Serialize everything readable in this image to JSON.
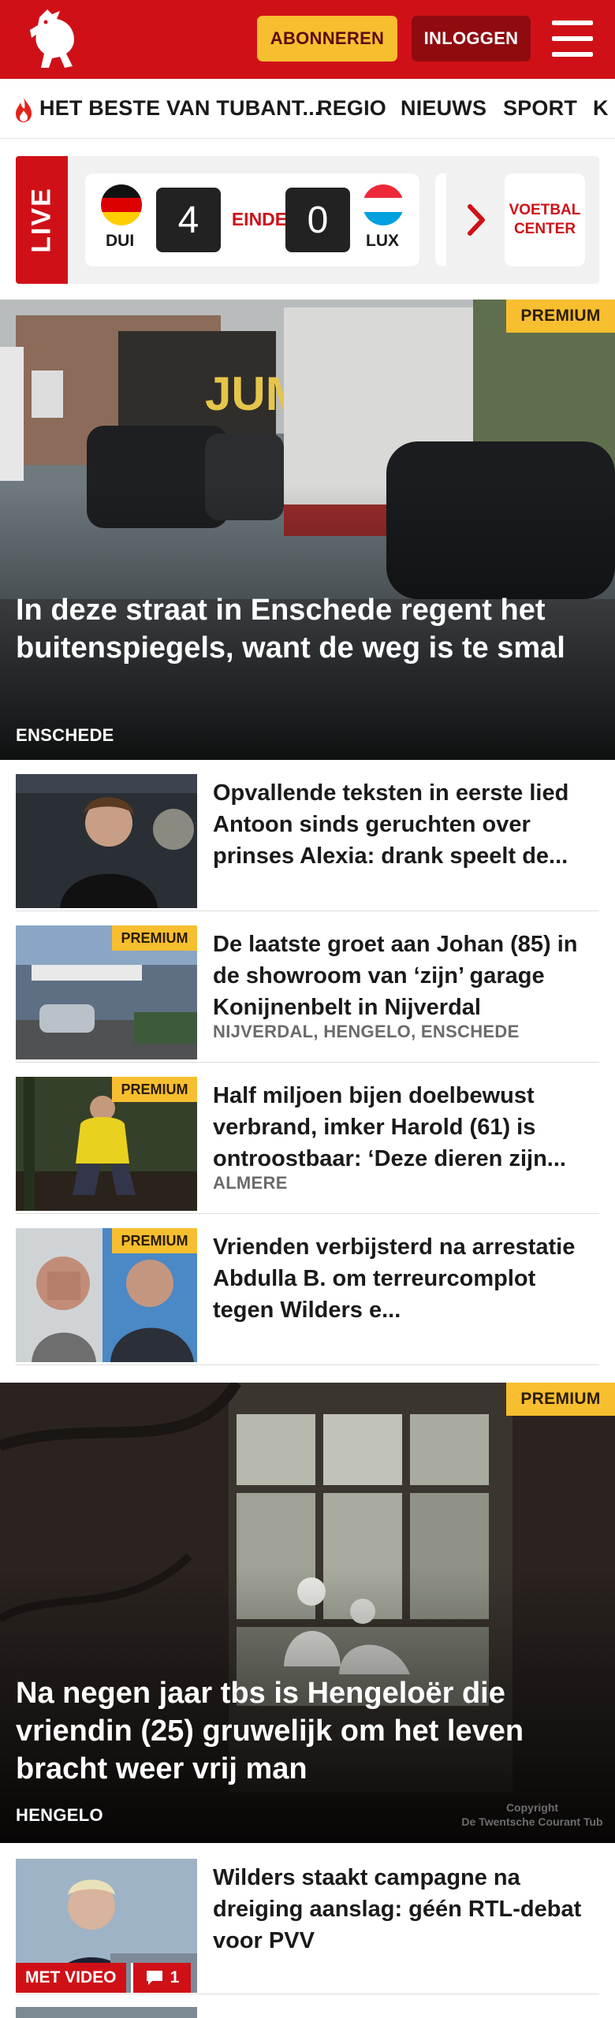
{
  "header": {
    "subscribe_label": "ABONNEREN",
    "login_label": "INLOGGEN",
    "brand_color": "#cf1117",
    "accent_color": "#f7be2f"
  },
  "nav": {
    "items": [
      {
        "label": "HET BESTE VAN TUBANT..."
      },
      {
        "label": "REGIO"
      },
      {
        "label": "NIEUWS"
      },
      {
        "label": "SPORT"
      },
      {
        "label": "K"
      }
    ]
  },
  "live": {
    "tag": "LIVE",
    "match": {
      "home_team": "DUI",
      "home_score": "4",
      "status": "EINDE",
      "away_score": "0",
      "away_team": "LUX"
    },
    "football_center": {
      "line1": "VOETBAL",
      "line2": "CENTER"
    }
  },
  "hero1": {
    "badge": "PREMIUM",
    "title": "In deze straat in Enschede regent het buitenspiegels, want de weg is te smal",
    "location": "ENSCHEDE"
  },
  "articles": [
    {
      "badge": "",
      "title": "Opvallende teksten in eerste lied Antoon sinds geruchten over prinses Alexia: drank speelt de...",
      "location": ""
    },
    {
      "badge": "PREMIUM",
      "title": "De laatste groet aan Johan (85) in de showroom van ‘zijn’ garage Konijnenbelt in Nijverdal",
      "location": "NIJVERDAL, HENGELO, ENSCHEDE"
    },
    {
      "badge": "PREMIUM",
      "title": "Half miljoen bijen doelbewust verbrand, imker Harold (61) is ontroostbaar: ‘Deze dieren zijn...",
      "location": "ALMERE"
    },
    {
      "badge": "PREMIUM",
      "title": "Vrienden verbijsterd na arrestatie Abdulla B. om terreurcomplot tegen Wilders e...",
      "location": ""
    }
  ],
  "hero2": {
    "badge": "PREMIUM",
    "title": "Na negen jaar tbs is Hengeloër die vriendin (25) gruwelijk om het leven bracht weer vrij man",
    "location": "HENGELO",
    "photo_credit_line1": "Copyright",
    "photo_credit_line2": "De Twentsche Courant Tub"
  },
  "article_video": {
    "title": "Wilders staakt campagne na dreiging aanslag: géén RTL-debat voor PVV",
    "video_badge": "MET VIDEO",
    "comment_count": "1"
  }
}
